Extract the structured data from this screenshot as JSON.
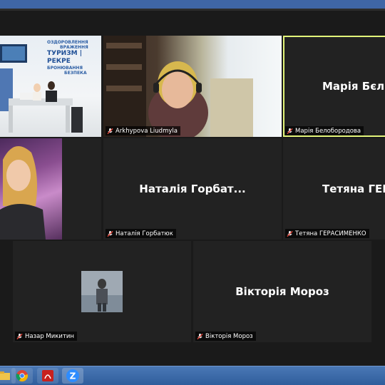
{
  "participants": [
    {
      "id": "studio",
      "label": "",
      "video": true
    },
    {
      "id": "arkhypova",
      "label": "Arkhypova Liudmyla",
      "video": true
    },
    {
      "id": "bieloborodova",
      "label": "Марія Белобородова",
      "display": "Марія Бєл",
      "video": false,
      "active": true
    },
    {
      "id": "portrait",
      "label": "",
      "video": true
    },
    {
      "id": "horbatiuk",
      "label": "Наталія Горбатюк",
      "display": "Наталія Горбат...",
      "video": false
    },
    {
      "id": "herasymenko",
      "label": "Тетяна ГЕРАСИМЕНКО",
      "display": "Тетяна  ГЕР",
      "video": false
    },
    {
      "id": "mykytyn",
      "label": "Назар Микитин",
      "video": false,
      "avatar": true
    },
    {
      "id": "moroz",
      "label": "Вікторія Мороз",
      "display": "Вікторія Мороз",
      "video": false
    }
  ],
  "studio_sign": {
    "lines": [
      "ОЗДОРОВЛЕННЯ",
      "ВРАЖЕННЯ",
      "ТУРИЗМ | РЕКРЕ",
      "БРОНЮВАННЯ",
      "БЕЗПЕКА"
    ]
  },
  "colors": {
    "active_border": "#e3f57a",
    "taskbar": "#2f5d9c",
    "mic_muted": "#e0453a"
  },
  "taskbar": {
    "apps": [
      {
        "name": "folder"
      },
      {
        "name": "chrome"
      },
      {
        "name": "acrobat"
      },
      {
        "name": "zoom",
        "label": "Z"
      }
    ]
  }
}
